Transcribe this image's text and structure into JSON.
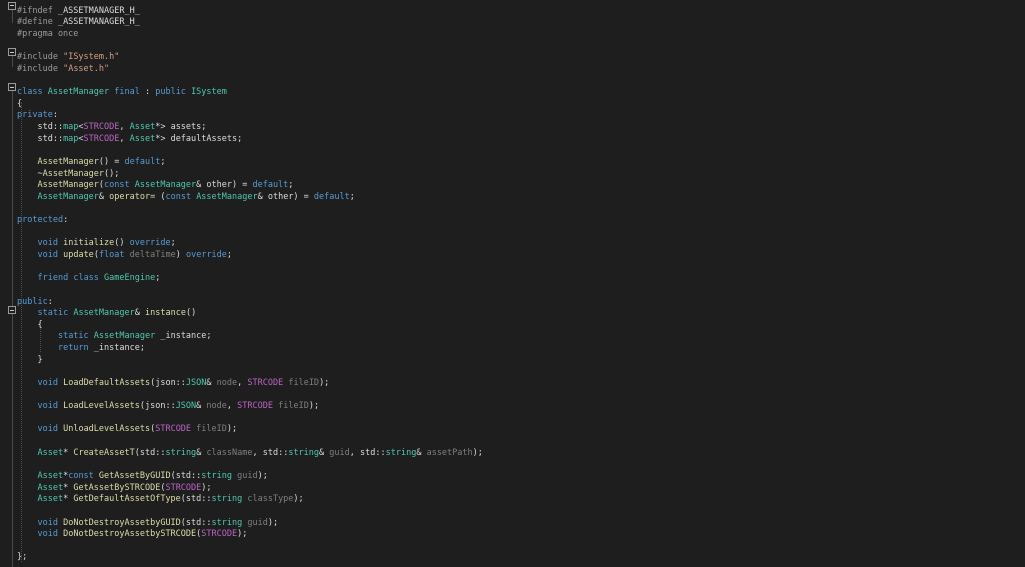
{
  "editor": {
    "colors": {
      "background": "#1e1e1e",
      "keyword": "#569cd6",
      "type": "#4ec9b0",
      "function": "#dcdcaa",
      "string": "#d69d85",
      "preprocessor": "#9b9b9b",
      "parameter": "#7f7f7f",
      "plain": "#dcdcdc"
    },
    "fold_markers": [
      "preprocessor-block-1",
      "preprocessor-block-2",
      "class-block",
      "method-block"
    ],
    "lines": [
      [
        [
          "pre",
          "#ifndef"
        ],
        [
          "pl",
          " _ASSETMANAGER_H_"
        ]
      ],
      [
        [
          "pre",
          "#define"
        ],
        [
          "pl",
          " _ASSETMANAGER_H_"
        ]
      ],
      [
        [
          "pre",
          "#pragma once"
        ]
      ],
      [],
      [
        [
          "pre",
          "#include"
        ],
        [
          "pl",
          " "
        ],
        [
          "str",
          "\"ISystem.h\""
        ]
      ],
      [
        [
          "pre",
          "#include"
        ],
        [
          "pl",
          " "
        ],
        [
          "str",
          "\"Asset.h\""
        ]
      ],
      [],
      [
        [
          "kw",
          "class"
        ],
        [
          "pl",
          " "
        ],
        [
          "ty",
          "AssetManager"
        ],
        [
          "pl",
          " "
        ],
        [
          "kw",
          "final"
        ],
        [
          "pl",
          " : "
        ],
        [
          "kw",
          "public"
        ],
        [
          "pl",
          " "
        ],
        [
          "ty",
          "ISystem"
        ]
      ],
      [
        [
          "pl",
          "{"
        ]
      ],
      [
        [
          "kw",
          "private"
        ],
        [
          "pl",
          ":"
        ]
      ],
      [
        [
          "pl",
          "    std::"
        ],
        [
          "ty",
          "map"
        ],
        [
          "pl",
          "<"
        ],
        [
          "mac",
          "STRCODE"
        ],
        [
          "pl",
          ", "
        ],
        [
          "ty",
          "Asset"
        ],
        [
          "pl",
          "*> assets;"
        ]
      ],
      [
        [
          "pl",
          "    std::"
        ],
        [
          "ty",
          "map"
        ],
        [
          "pl",
          "<"
        ],
        [
          "mac",
          "STRCODE"
        ],
        [
          "pl",
          ", "
        ],
        [
          "ty",
          "Asset"
        ],
        [
          "pl",
          "*> defaultAssets;"
        ]
      ],
      [],
      [
        [
          "pl",
          "    "
        ],
        [
          "fn",
          "AssetManager"
        ],
        [
          "pl",
          "() = "
        ],
        [
          "kw",
          "default"
        ],
        [
          "pl",
          ";"
        ]
      ],
      [
        [
          "pl",
          "    ~"
        ],
        [
          "fn",
          "AssetManager"
        ],
        [
          "pl",
          "();"
        ]
      ],
      [
        [
          "pl",
          "    "
        ],
        [
          "fn",
          "AssetManager"
        ],
        [
          "pl",
          "("
        ],
        [
          "kw",
          "const"
        ],
        [
          "pl",
          " "
        ],
        [
          "ty",
          "AssetManager"
        ],
        [
          "pl",
          "& other) = "
        ],
        [
          "kw",
          "default"
        ],
        [
          "pl",
          ";"
        ]
      ],
      [
        [
          "pl",
          "    "
        ],
        [
          "ty",
          "AssetManager"
        ],
        [
          "pl",
          "& "
        ],
        [
          "fn",
          "operator="
        ],
        [
          "pl",
          " ("
        ],
        [
          "kw",
          "const"
        ],
        [
          "pl",
          " "
        ],
        [
          "ty",
          "AssetManager"
        ],
        [
          "pl",
          "& other) = "
        ],
        [
          "kw",
          "default"
        ],
        [
          "pl",
          ";"
        ]
      ],
      [],
      [
        [
          "kw",
          "protected"
        ],
        [
          "pl",
          ":"
        ]
      ],
      [],
      [
        [
          "pl",
          "    "
        ],
        [
          "kw",
          "void"
        ],
        [
          "pl",
          " "
        ],
        [
          "fn",
          "initialize"
        ],
        [
          "pl",
          "() "
        ],
        [
          "kw",
          "override"
        ],
        [
          "pl",
          ";"
        ]
      ],
      [
        [
          "pl",
          "    "
        ],
        [
          "kw",
          "void"
        ],
        [
          "pl",
          " "
        ],
        [
          "fn",
          "update"
        ],
        [
          "pl",
          "("
        ],
        [
          "kw",
          "float"
        ],
        [
          "pl",
          " "
        ],
        [
          "par",
          "deltaTime"
        ],
        [
          "pl",
          ") "
        ],
        [
          "kw",
          "override"
        ],
        [
          "pl",
          ";"
        ]
      ],
      [],
      [
        [
          "pl",
          "    "
        ],
        [
          "kw",
          "friend"
        ],
        [
          "pl",
          " "
        ],
        [
          "kw",
          "class"
        ],
        [
          "pl",
          " "
        ],
        [
          "ty",
          "GameEngine"
        ],
        [
          "pl",
          ";"
        ]
      ],
      [],
      [
        [
          "kw",
          "public"
        ],
        [
          "pl",
          ":"
        ]
      ],
      [
        [
          "pl",
          "    "
        ],
        [
          "kw",
          "static"
        ],
        [
          "pl",
          " "
        ],
        [
          "ty",
          "AssetManager"
        ],
        [
          "pl",
          "& "
        ],
        [
          "fn",
          "instance"
        ],
        [
          "pl",
          "()"
        ]
      ],
      [
        [
          "pl",
          "    {"
        ]
      ],
      [
        [
          "pl",
          "        "
        ],
        [
          "kw",
          "static"
        ],
        [
          "pl",
          " "
        ],
        [
          "ty",
          "AssetManager"
        ],
        [
          "pl",
          " "
        ],
        [
          "var",
          "_instance"
        ],
        [
          "pl",
          ";"
        ]
      ],
      [
        [
          "pl",
          "        "
        ],
        [
          "kw",
          "return"
        ],
        [
          "pl",
          " _instance;"
        ]
      ],
      [
        [
          "pl",
          "    }"
        ]
      ],
      [],
      [
        [
          "pl",
          "    "
        ],
        [
          "kw",
          "void"
        ],
        [
          "pl",
          " "
        ],
        [
          "fn",
          "LoadDefaultAssets"
        ],
        [
          "pl",
          "(json::"
        ],
        [
          "ty",
          "JSON"
        ],
        [
          "pl",
          "& "
        ],
        [
          "par",
          "node"
        ],
        [
          "pl",
          ", "
        ],
        [
          "mac",
          "STRCODE"
        ],
        [
          "pl",
          " "
        ],
        [
          "par",
          "fileID"
        ],
        [
          "pl",
          ");"
        ]
      ],
      [],
      [
        [
          "pl",
          "    "
        ],
        [
          "kw",
          "void"
        ],
        [
          "pl",
          " "
        ],
        [
          "fn",
          "LoadLevelAssets"
        ],
        [
          "pl",
          "(json::"
        ],
        [
          "ty",
          "JSON"
        ],
        [
          "pl",
          "& "
        ],
        [
          "par",
          "node"
        ],
        [
          "pl",
          ", "
        ],
        [
          "mac",
          "STRCODE"
        ],
        [
          "pl",
          " "
        ],
        [
          "par",
          "fileID"
        ],
        [
          "pl",
          ");"
        ]
      ],
      [],
      [
        [
          "pl",
          "    "
        ],
        [
          "kw",
          "void"
        ],
        [
          "pl",
          " "
        ],
        [
          "fn",
          "UnloadLevelAssets"
        ],
        [
          "pl",
          "("
        ],
        [
          "mac",
          "STRCODE"
        ],
        [
          "pl",
          " "
        ],
        [
          "par",
          "fileID"
        ],
        [
          "pl",
          ");"
        ]
      ],
      [],
      [
        [
          "pl",
          "    "
        ],
        [
          "ty",
          "Asset"
        ],
        [
          "pl",
          "* "
        ],
        [
          "fn",
          "CreateAssetT"
        ],
        [
          "pl",
          "(std::"
        ],
        [
          "ty",
          "string"
        ],
        [
          "pl",
          "& "
        ],
        [
          "par",
          "className"
        ],
        [
          "pl",
          ", std::"
        ],
        [
          "ty",
          "string"
        ],
        [
          "pl",
          "& "
        ],
        [
          "par",
          "guid"
        ],
        [
          "pl",
          ", std::"
        ],
        [
          "ty",
          "string"
        ],
        [
          "pl",
          "& "
        ],
        [
          "par",
          "assetPath"
        ],
        [
          "pl",
          ");"
        ]
      ],
      [],
      [
        [
          "pl",
          "    "
        ],
        [
          "ty",
          "Asset"
        ],
        [
          "pl",
          "*"
        ],
        [
          "kw",
          "const"
        ],
        [
          "pl",
          " "
        ],
        [
          "fn",
          "GetAssetByGUID"
        ],
        [
          "pl",
          "(std::"
        ],
        [
          "ty",
          "string"
        ],
        [
          "pl",
          " "
        ],
        [
          "par",
          "guid"
        ],
        [
          "pl",
          ");"
        ]
      ],
      [
        [
          "pl",
          "    "
        ],
        [
          "ty",
          "Asset"
        ],
        [
          "pl",
          "* "
        ],
        [
          "fn",
          "GetAssetBySTRCODE"
        ],
        [
          "pl",
          "("
        ],
        [
          "mac",
          "STRCODE"
        ],
        [
          "pl",
          ");"
        ]
      ],
      [
        [
          "pl",
          "    "
        ],
        [
          "ty",
          "Asset"
        ],
        [
          "pl",
          "* "
        ],
        [
          "fn",
          "GetDefaultAssetOfType"
        ],
        [
          "pl",
          "(std::"
        ],
        [
          "ty",
          "string"
        ],
        [
          "pl",
          " "
        ],
        [
          "par",
          "classType"
        ],
        [
          "pl",
          ");"
        ]
      ],
      [],
      [
        [
          "pl",
          "    "
        ],
        [
          "kw",
          "void"
        ],
        [
          "pl",
          " "
        ],
        [
          "fn",
          "DoNotDestroyAssetbyGUID"
        ],
        [
          "pl",
          "(std::"
        ],
        [
          "ty",
          "string"
        ],
        [
          "pl",
          " "
        ],
        [
          "par",
          "guid"
        ],
        [
          "pl",
          ");"
        ]
      ],
      [
        [
          "pl",
          "    "
        ],
        [
          "kw",
          "void"
        ],
        [
          "pl",
          " "
        ],
        [
          "fn",
          "DoNotDestroyAssetbySTRCODE"
        ],
        [
          "pl",
          "("
        ],
        [
          "mac",
          "STRCODE"
        ],
        [
          "pl",
          ");"
        ]
      ],
      [],
      [
        [
          "pl",
          "};"
        ]
      ]
    ]
  }
}
